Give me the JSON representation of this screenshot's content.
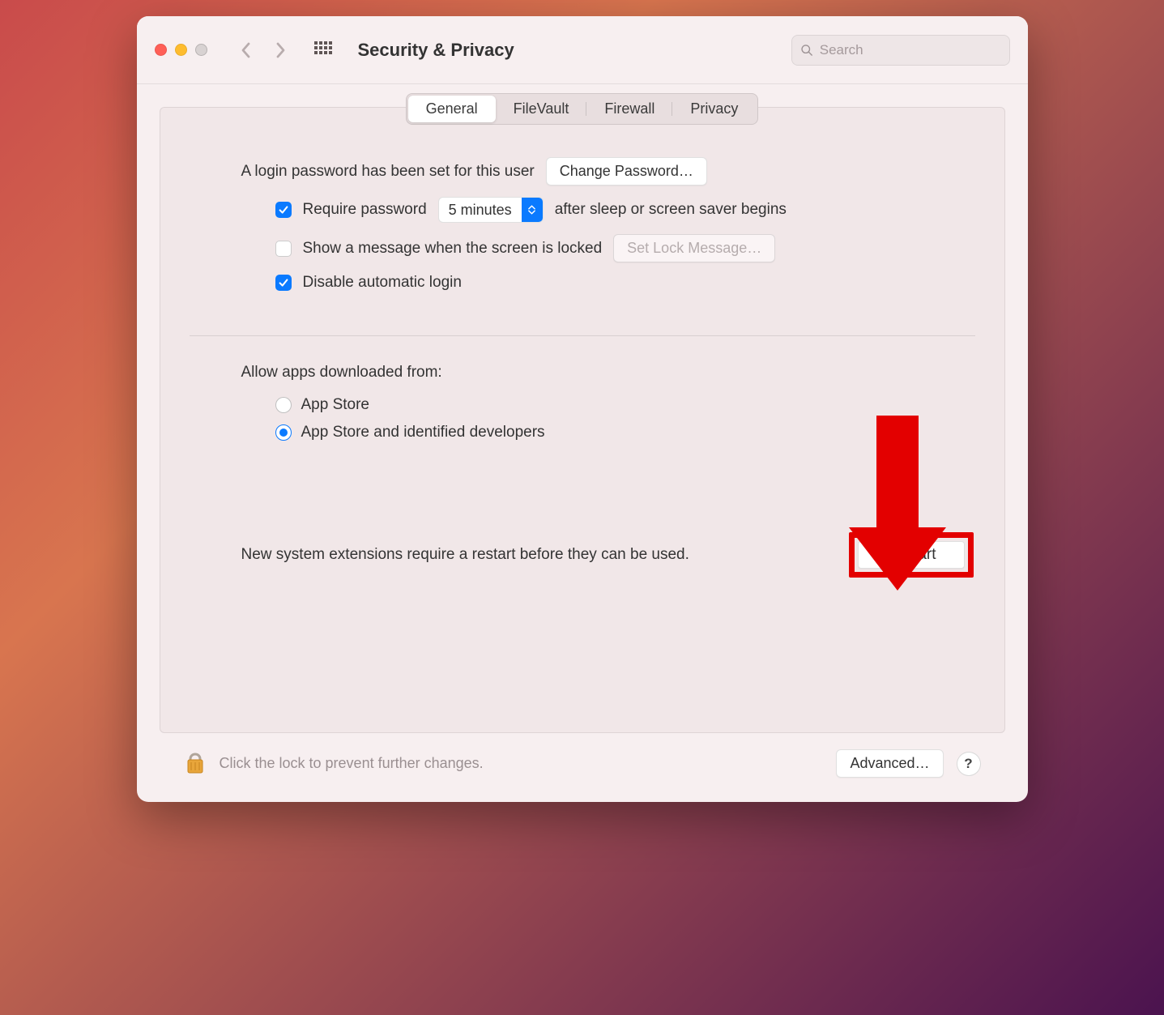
{
  "toolbar": {
    "title": "Security & Privacy",
    "search_placeholder": "Search"
  },
  "tabs": {
    "general": "General",
    "filevault": "FileVault",
    "firewall": "Firewall",
    "privacy": "Privacy"
  },
  "general": {
    "login_password_text": "A login password has been set for this user",
    "change_password_btn": "Change Password…",
    "require_password_label": "Require password",
    "require_password_delay": "5 minutes",
    "require_password_suffix": "after sleep or screen saver begins",
    "show_message_label": "Show a message when the screen is locked",
    "set_lock_message_btn": "Set Lock Message…",
    "disable_auto_login_label": "Disable automatic login"
  },
  "allow_apps": {
    "heading": "Allow apps downloaded from:",
    "option_appstore": "App Store",
    "option_identified": "App Store and identified developers"
  },
  "restart": {
    "message": "New system extensions require a restart before they can be used.",
    "button": "Restart"
  },
  "footer": {
    "lock_text": "Click the lock to prevent further changes.",
    "advanced_btn": "Advanced…",
    "help": "?"
  }
}
